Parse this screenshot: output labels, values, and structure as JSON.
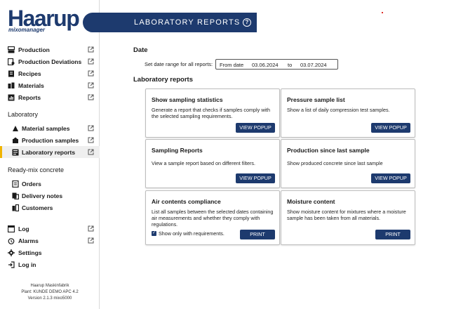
{
  "brand": {
    "name": "Haarup",
    "sub": "mixomanager"
  },
  "header": {
    "title": "LABORATORY REPORTS",
    "help": "?"
  },
  "nav_top": [
    {
      "label": "Production",
      "icon": "production-icon",
      "ext": true
    },
    {
      "label": "Production Deviations",
      "icon": "deviations-icon",
      "ext": true
    },
    {
      "label": "Recipes",
      "icon": "recipes-icon",
      "ext": true
    },
    {
      "label": "Materials",
      "icon": "materials-icon",
      "ext": true
    },
    {
      "label": "Reports",
      "icon": "reports-icon",
      "ext": true
    }
  ],
  "section_laboratory": "Laboratory",
  "nav_laboratory": [
    {
      "label": "Material samples",
      "icon": "material-samples-icon",
      "ext": true
    },
    {
      "label": "Production samples",
      "icon": "production-samples-icon",
      "ext": true
    },
    {
      "label": "Laboratory reports",
      "icon": "laboratory-reports-icon",
      "ext": true,
      "active": true
    }
  ],
  "section_readymix": "Ready-mix concrete",
  "nav_readymix": [
    {
      "label": "Orders",
      "icon": "orders-icon"
    },
    {
      "label": "Delivery notes",
      "icon": "delivery-notes-icon"
    },
    {
      "label": "Customers",
      "icon": "customers-icon"
    }
  ],
  "nav_bottom": [
    {
      "label": "Log",
      "icon": "log-icon",
      "ext": true
    },
    {
      "label": "Alarms",
      "icon": "alarms-icon",
      "ext": true
    },
    {
      "label": "Settings",
      "icon": "settings-icon"
    },
    {
      "label": "Log in",
      "icon": "login-icon"
    }
  ],
  "footer": {
    "line1": "Haarup Maskinfabrik",
    "line2": "Plant: KUNDE DEMO APC 4.2",
    "line3": "Version 2.1.3  mixo5000"
  },
  "date": {
    "heading": "Date",
    "label": "Set date range for all reports:",
    "from_label": "From date",
    "from_value": "03.06.2024",
    "to_label": "to",
    "to_value": "03.07.2024"
  },
  "lab_heading": "Laboratory reports",
  "cards": [
    {
      "title": "Show sampling statistics",
      "desc": "Generate a report that checks if samples comply with the selected sampling requirements.",
      "button": "VIEW POPUP"
    },
    {
      "title": "Pressure sample list",
      "desc": "Show a list of daily compression test samples.",
      "button": "VIEW POPUP"
    },
    {
      "title": "Sampling Reports",
      "desc": "View a sample report based on different filters.",
      "button": "VIEW POPUP"
    },
    {
      "title": "Production since last sample",
      "desc": "Show produced concrete since last sample",
      "button": "VIEW POPUP"
    },
    {
      "title": "Air contents compliance",
      "desc": "List all samples between the selected dates containing air measurements and whether they comply with regulations.",
      "checkbox": "Show only with requirements.",
      "button": "PRINT"
    },
    {
      "title": "Moisture content",
      "desc": "Show moisture content for mixtures where a moisture sample has been taken from all materials.",
      "button": "PRINT"
    }
  ]
}
